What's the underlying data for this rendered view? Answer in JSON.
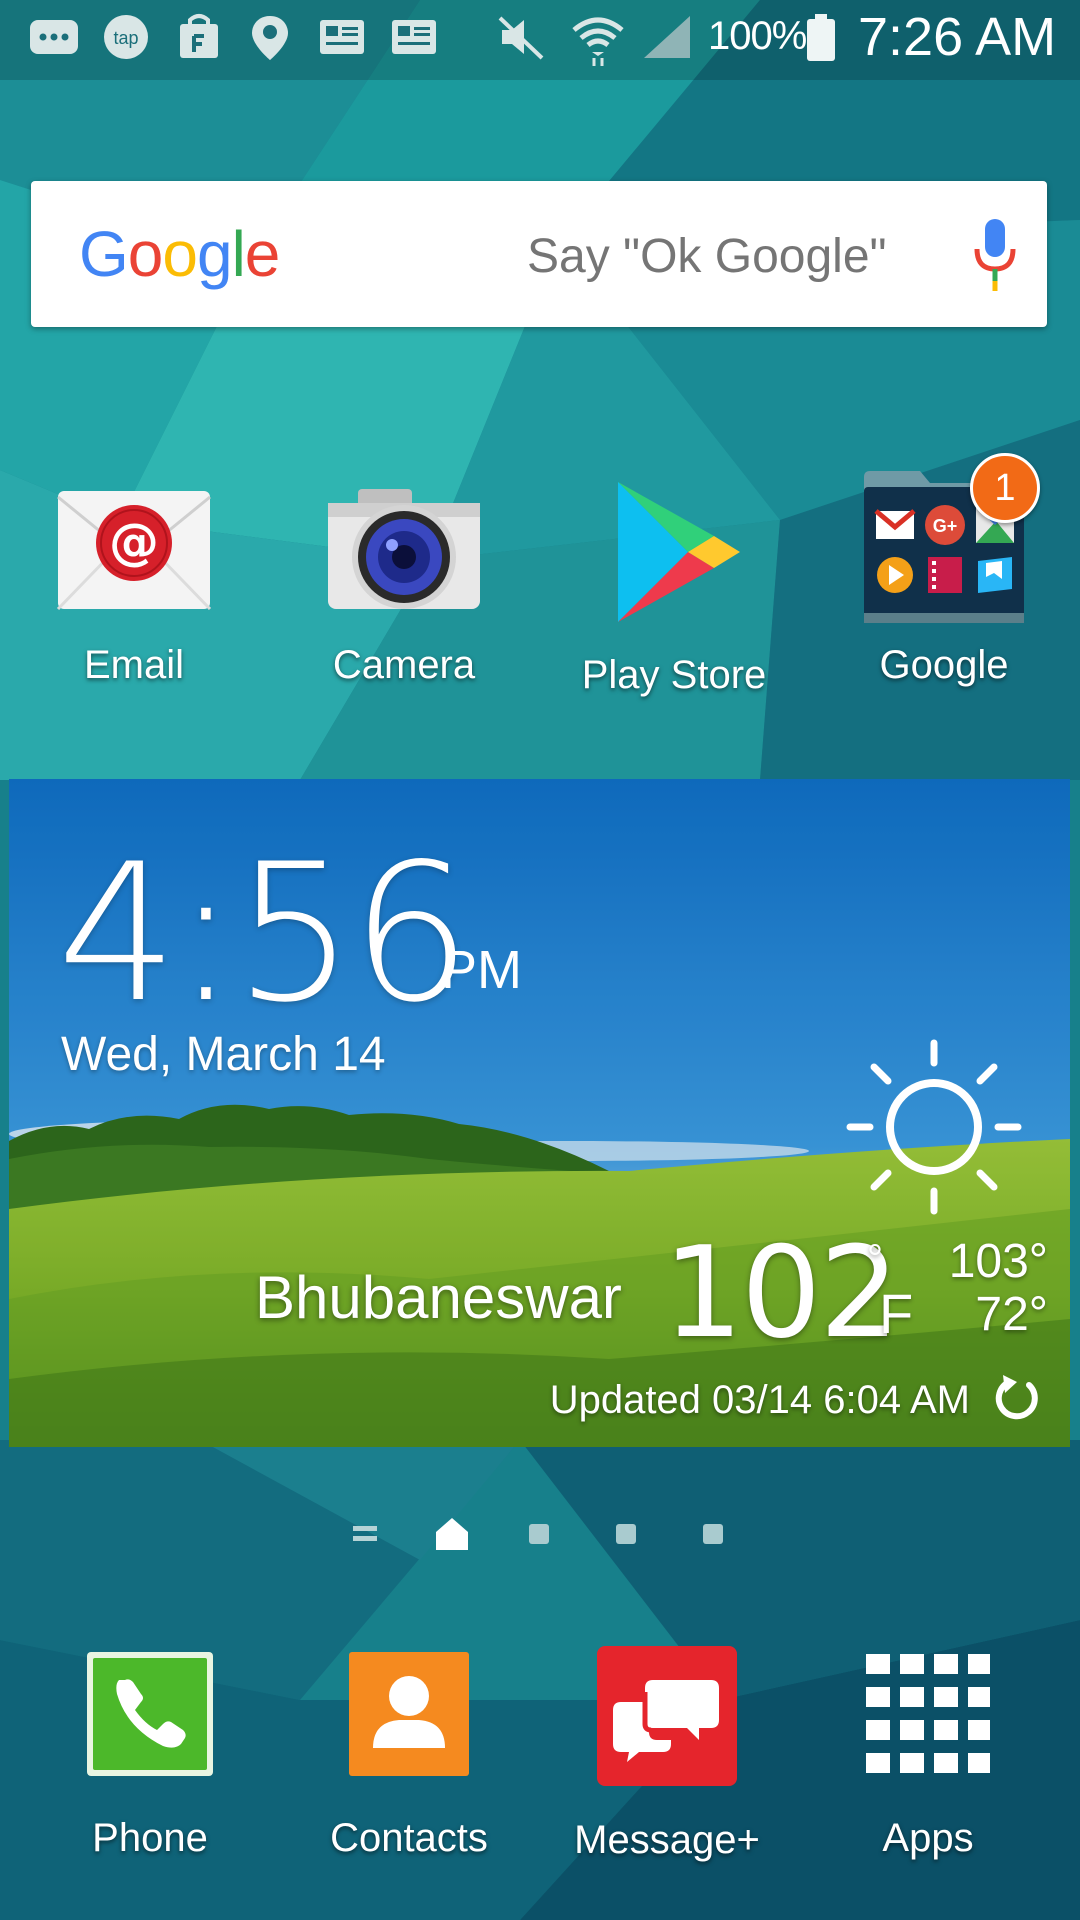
{
  "status_bar": {
    "battery_percent": "100%",
    "time": "7:26 AM",
    "icons": [
      "chat-icon",
      "tap-icon",
      "shopping-bag-icon",
      "location-icon",
      "news-icon",
      "news-icon",
      "mute-icon",
      "wifi-icon",
      "signal-icon",
      "battery-icon"
    ],
    "tap_text": "tap"
  },
  "search": {
    "logo": [
      "G",
      "o",
      "o",
      "g",
      "l",
      "e"
    ],
    "logo_colors": [
      "#4285F4",
      "#EA4335",
      "#FBBC05",
      "#4285F4",
      "#34A853",
      "#EA4335"
    ],
    "hint": "Say \"Ok Google\""
  },
  "apps": [
    {
      "label": "Email",
      "icon": "email-icon"
    },
    {
      "label": "Camera",
      "icon": "camera-icon"
    },
    {
      "label": "Play Store",
      "icon": "play-store-icon"
    },
    {
      "label": "Google",
      "icon": "google-folder-icon",
      "badge": "1"
    }
  ],
  "weather": {
    "time": "4:56",
    "ampm": "PM",
    "date": "Wed, March 14",
    "city": "Bhubaneswar",
    "temp": "102",
    "degree": "°",
    "unit": "F",
    "high": "103°",
    "low": "72°",
    "updated": "Updated 03/14 6:04 AM",
    "condition_icon": "sun-icon"
  },
  "pages": [
    "menu-page",
    "home-page",
    "page",
    "page",
    "page"
  ],
  "dock": [
    {
      "label": "Phone",
      "icon": "phone-icon",
      "color": "#4CB82A"
    },
    {
      "label": "Contacts",
      "icon": "contacts-icon",
      "color": "#F58A1F"
    },
    {
      "label": "Message+",
      "icon": "message-icon",
      "color": "#E5252C"
    },
    {
      "label": "Apps",
      "icon": "apps-grid-icon",
      "color": "#FFFFFF"
    }
  ]
}
